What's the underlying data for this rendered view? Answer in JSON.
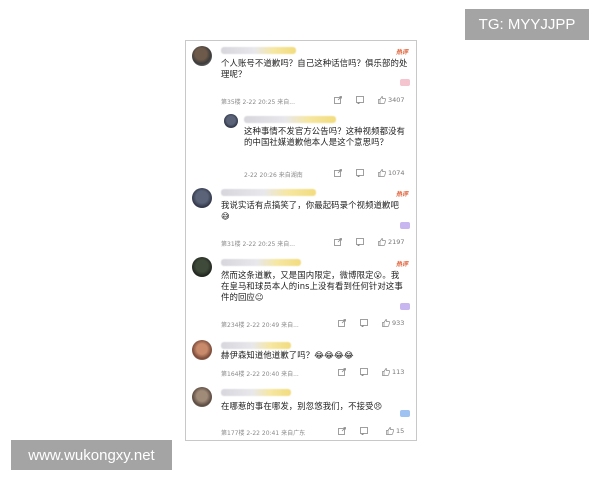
{
  "watermarks": {
    "top_right": "TG: MYYJJPP",
    "bottom_left": "www.wukongxy.net"
  },
  "colors": {
    "hot_tag": "#e0623a",
    "meta_text": "#8a8a8a",
    "body_text": "#222222"
  },
  "comments": [
    {
      "hot": "热评",
      "text": "个人账号不道歉吗？自己这种话信吗？俱乐部的处理呢？",
      "meta": "第35楼 2-22 20:25 来自...",
      "likes": "3407"
    },
    {
      "text": "这种事情不发官方公告吗？这种视频都没有的中国社媒道歉他本人是这个意思吗？",
      "meta": "2-22 20:26 来自湖南",
      "likes": "1074"
    },
    {
      "hot": "热评",
      "text": "我说实话有点搞笑了，你最起码录个视频道歉吧😅",
      "meta": "第31楼 2-22 20:25 来自...",
      "likes": "2197"
    },
    {
      "hot": "热评",
      "text": "然而这条道歉，又是国内限定，微博限定😮。我在皇马和球员本人的ins上没有看到任何针对这事件的回应😐",
      "meta": "第234楼 2-22 20:49 来自...",
      "likes": "933"
    },
    {
      "text": "赫伊森知道他道歉了吗？😂😂😂😂",
      "meta": "第164楼 2-22 20:40 来自...",
      "likes": "113"
    },
    {
      "text": "在哪惹的事在哪发，别忽悠我们，不接受😠",
      "meta": "第177楼 2-22 20:41 来自广东",
      "likes": "15"
    }
  ]
}
